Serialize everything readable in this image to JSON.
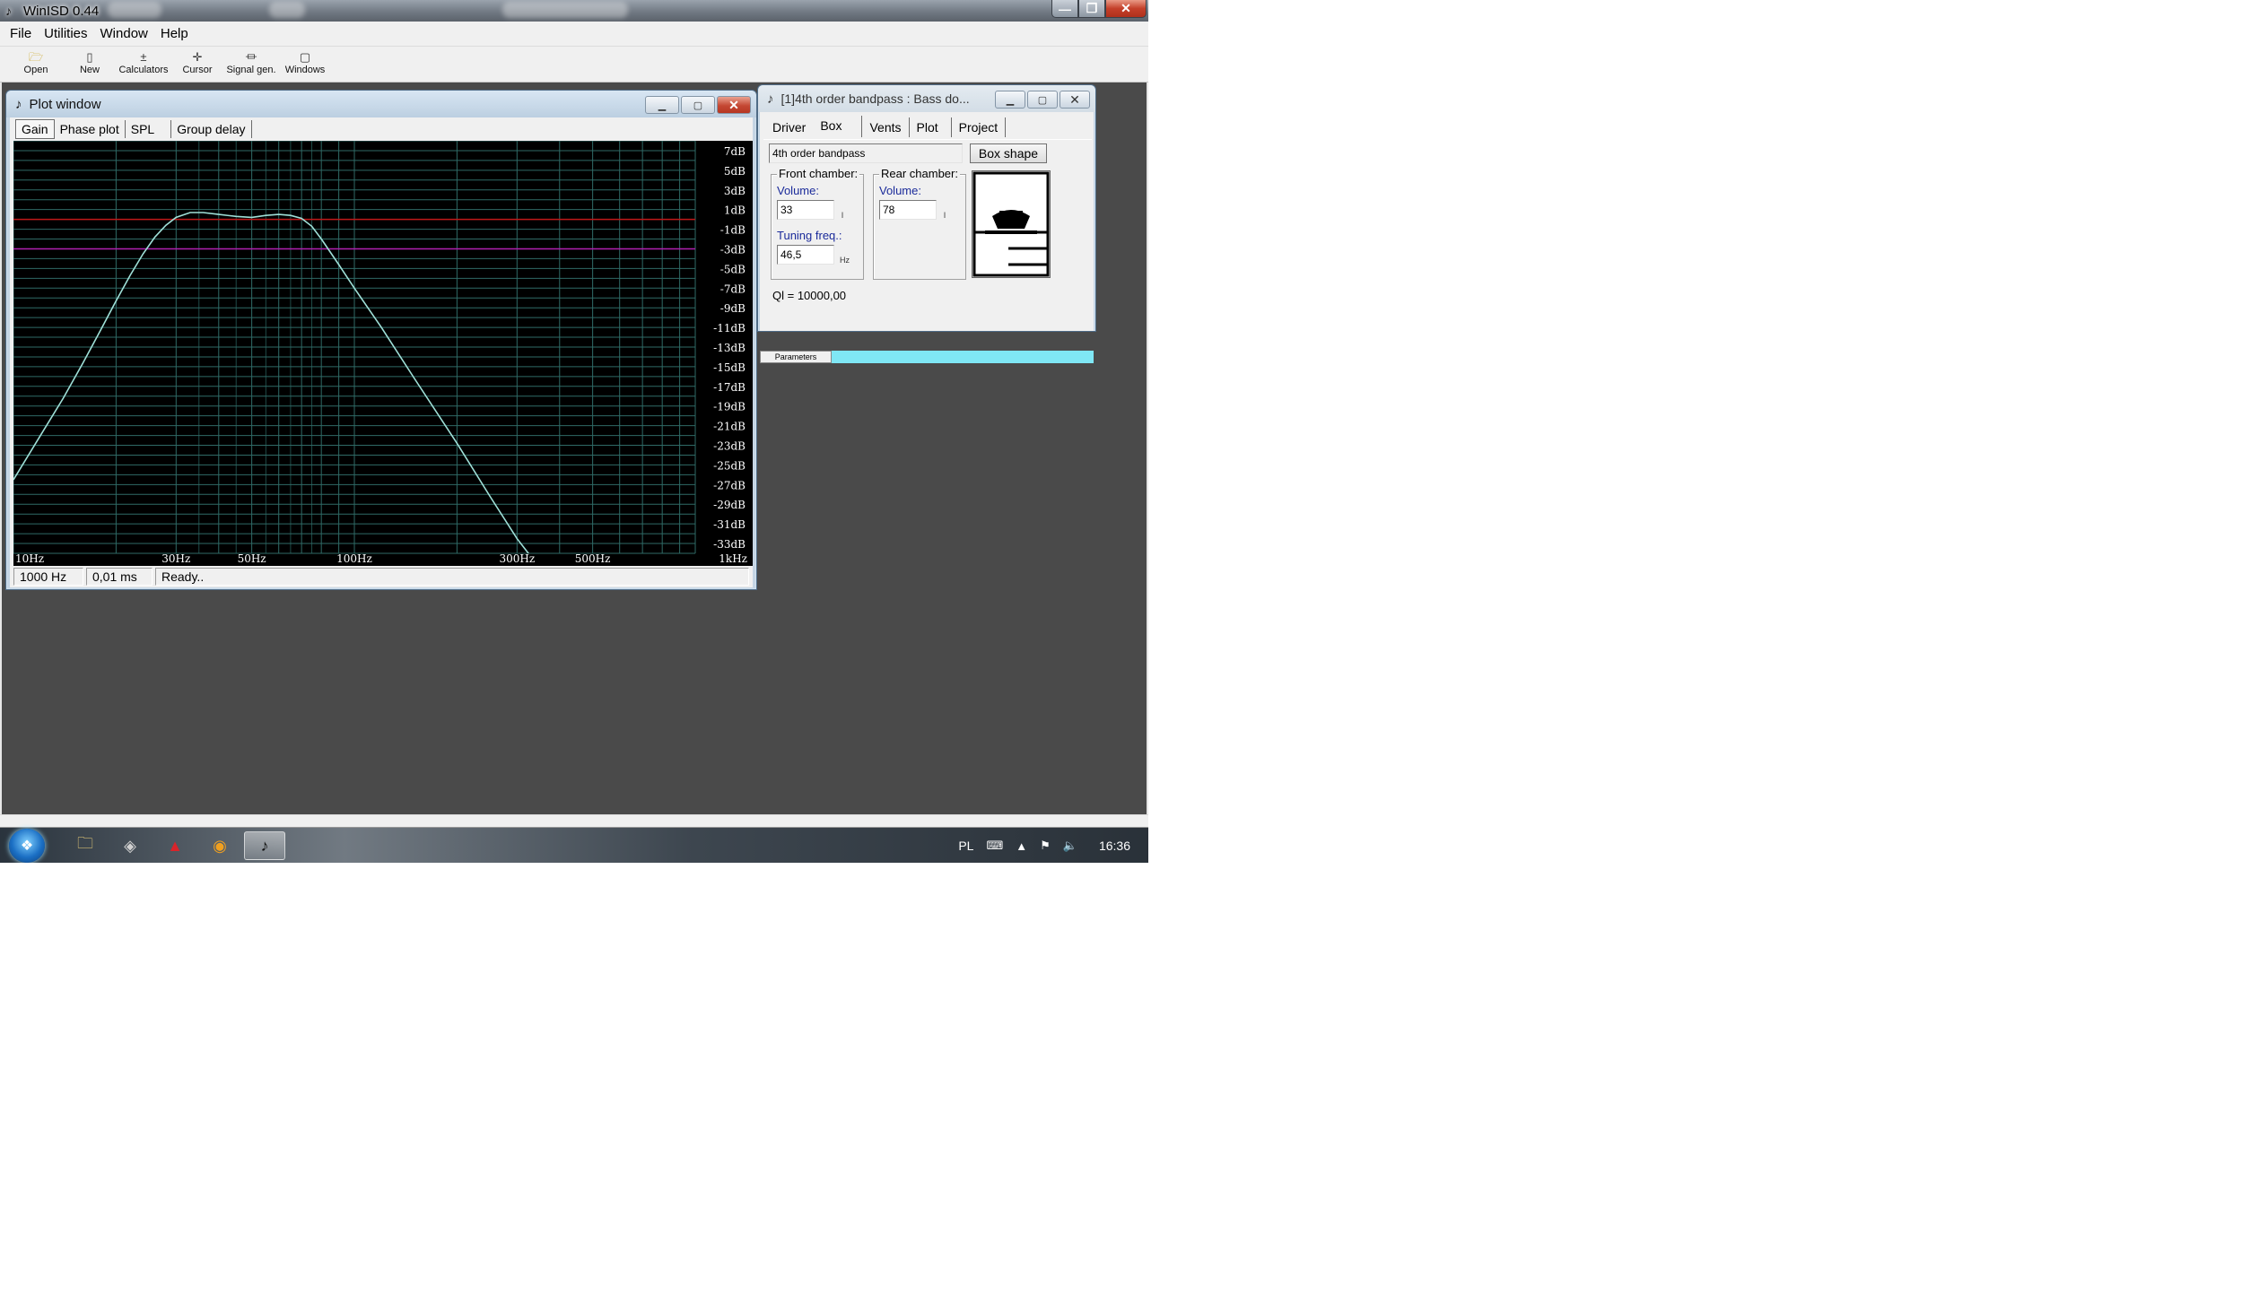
{
  "app": {
    "title": "WinISD 0.44",
    "caption_buttons": [
      "—",
      "❐",
      "✕"
    ]
  },
  "menu": [
    "File",
    "Utilities",
    "Window",
    "Help"
  ],
  "toolbar": [
    {
      "label": "Open",
      "icon": "folder-open-icon",
      "glyph": "🗁"
    },
    {
      "label": "New",
      "icon": "new-document-icon",
      "glyph": "▯"
    },
    {
      "label": "Calculators",
      "icon": "calculator-icon",
      "glyph": "±"
    },
    {
      "label": "Cursor",
      "icon": "cursor-crosshair-icon",
      "glyph": "✛"
    },
    {
      "label": "Signal gen.",
      "icon": "signal-generator-icon",
      "glyph": "⏛"
    },
    {
      "label": "Windows",
      "icon": "windows-icon",
      "glyph": "▢"
    }
  ],
  "plot_window": {
    "title": "Plot window",
    "tabs": [
      "Gain",
      "Phase plot",
      "SPL",
      "Group delay"
    ],
    "active_tab": "Gain",
    "status": [
      "1000 Hz",
      "0,01 ms",
      "Ready.."
    ]
  },
  "chart_data": {
    "type": "line",
    "x_scale": "log",
    "xlim": [
      10,
      1000
    ],
    "ylim": [
      -34,
      8
    ],
    "grid": true,
    "x_tick_labels": [
      {
        "x": 10,
        "label": "10Hz"
      },
      {
        "x": 30,
        "label": "30Hz"
      },
      {
        "x": 50,
        "label": "50Hz"
      },
      {
        "x": 100,
        "label": "100Hz"
      },
      {
        "x": 300,
        "label": "300Hz"
      },
      {
        "x": 500,
        "label": "500Hz"
      },
      {
        "x": 1000,
        "label": "1kHz"
      }
    ],
    "y_tick_labels": [
      {
        "y": 7,
        "label": "7dB"
      },
      {
        "y": 5,
        "label": "5dB"
      },
      {
        "y": 3,
        "label": "3dB"
      },
      {
        "y": 1,
        "label": "1dB"
      },
      {
        "y": -1,
        "label": "-1dB"
      },
      {
        "y": -3,
        "label": "-3dB"
      },
      {
        "y": -5,
        "label": "-5dB"
      },
      {
        "y": -7,
        "label": "-7dB"
      },
      {
        "y": -9,
        "label": "-9dB"
      },
      {
        "y": -11,
        "label": "-11dB"
      },
      {
        "y": -13,
        "label": "-13dB"
      },
      {
        "y": -15,
        "label": "-15dB"
      },
      {
        "y": -17,
        "label": "-17dB"
      },
      {
        "y": -19,
        "label": "-19dB"
      },
      {
        "y": -21,
        "label": "-21dB"
      },
      {
        "y": -23,
        "label": "-23dB"
      },
      {
        "y": -25,
        "label": "-25dB"
      },
      {
        "y": -27,
        "label": "-27dB"
      },
      {
        "y": -29,
        "label": "-29dB"
      },
      {
        "y": -31,
        "label": "-31dB"
      },
      {
        "y": -33,
        "label": "-33dB"
      }
    ],
    "reference_lines": [
      {
        "y": 0,
        "color": "#c01818"
      },
      {
        "y": -3,
        "color": "#b020b0"
      }
    ],
    "series": [
      {
        "color": "#9fe0d8",
        "x": [
          10,
          12,
          14,
          16,
          18,
          20,
          22,
          24,
          26,
          28,
          30,
          33,
          36,
          40,
          45,
          50,
          55,
          60,
          65,
          70,
          75,
          80,
          90,
          100,
          120,
          150,
          200,
          250,
          300,
          350
        ],
        "y": [
          -26.5,
          -22.0,
          -18.2,
          -14.6,
          -11.3,
          -8.3,
          -5.7,
          -3.5,
          -1.8,
          -0.6,
          0.2,
          0.7,
          0.7,
          0.5,
          0.3,
          0.2,
          0.4,
          0.5,
          0.4,
          0.1,
          -0.7,
          -2.0,
          -4.6,
          -7.0,
          -11.0,
          -16.2,
          -22.8,
          -28.2,
          -32.5,
          -35.5
        ]
      }
    ]
  },
  "box_window": {
    "title": "[1]4th order bandpass : Bass do...",
    "tabs": [
      "Driver",
      "Box",
      "Vents",
      "Plot",
      "Project"
    ],
    "active_tab": "Box",
    "box_type": "4th order bandpass",
    "box_shape_button": "Box shape",
    "front_chamber": {
      "title": "Front chamber:",
      "volume_label": "Volume:",
      "volume_value": "33",
      "volume_unit": "l",
      "tuning_label": "Tuning freq.:",
      "tuning_value": "46,5",
      "tuning_unit": "Hz"
    },
    "rear_chamber": {
      "title": "Rear chamber:",
      "volume_label": "Volume:",
      "volume_value": "78",
      "volume_unit": "l"
    },
    "ql": "Ql = 10000,00",
    "status_tab": "Parameters"
  },
  "taskbar": {
    "items": [
      {
        "icon": "folder-icon",
        "glyph": "🗀"
      },
      {
        "icon": "media-icon",
        "glyph": "◈"
      },
      {
        "icon": "pdf-icon",
        "glyph": "▲"
      },
      {
        "icon": "app-orange-icon",
        "glyph": "◉"
      },
      {
        "icon": "winisd-icon",
        "glyph": "♪"
      }
    ],
    "lang": "PL",
    "clock": "16:36"
  }
}
